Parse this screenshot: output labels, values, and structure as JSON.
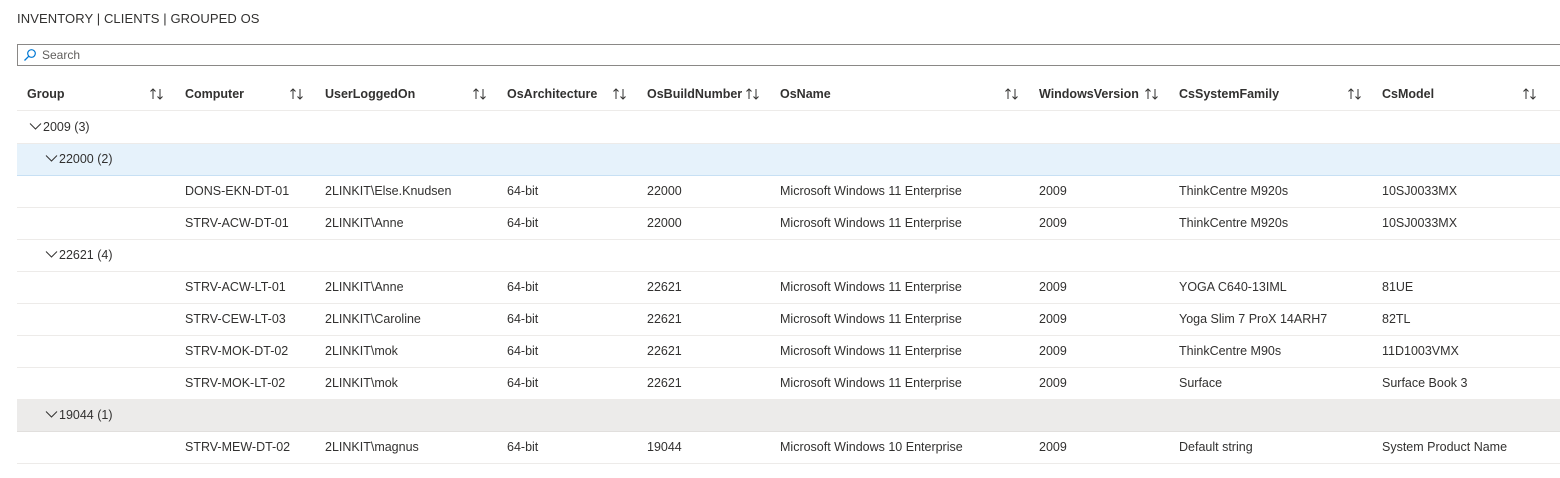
{
  "title": "INVENTORY | CLIENTS | GROUPED OS",
  "search": {
    "placeholder": "Search",
    "value": ""
  },
  "columns": [
    "Group",
    "Computer",
    "UserLoggedOn",
    "OsArchitecture",
    "OsBuildNumber",
    "OsName",
    "WindowsVersion",
    "CsSystemFamily",
    "CsModel"
  ],
  "groups": [
    {
      "label": "2009 (3)",
      "level": 1
    },
    {
      "label": "22000 (2)",
      "level": 2
    },
    {
      "label": "22621 (4)",
      "level": 2
    },
    {
      "label": "19044 (1)",
      "level": 2
    }
  ],
  "rows": [
    [
      "DONS-EKN-DT-01",
      "2LINKIT\\Else.Knudsen",
      "64-bit",
      "22000",
      "Microsoft Windows 11 Enterprise",
      "2009",
      "ThinkCentre M920s",
      "10SJ0033MX"
    ],
    [
      "STRV-ACW-DT-01",
      "2LINKIT\\Anne",
      "64-bit",
      "22000",
      "Microsoft Windows 11 Enterprise",
      "2009",
      "ThinkCentre M920s",
      "10SJ0033MX"
    ],
    [
      "STRV-ACW-LT-01",
      "2LINKIT\\Anne",
      "64-bit",
      "22621",
      "Microsoft Windows 11 Enterprise",
      "2009",
      "YOGA C640-13IML",
      "81UE"
    ],
    [
      "STRV-CEW-LT-03",
      "2LINKIT\\Caroline",
      "64-bit",
      "22621",
      "Microsoft Windows 11 Enterprise",
      "2009",
      "Yoga Slim 7 ProX 14ARH7",
      "82TL"
    ],
    [
      "STRV-MOK-DT-02",
      "2LINKIT\\mok",
      "64-bit",
      "22621",
      "Microsoft Windows 11 Enterprise",
      "2009",
      "ThinkCentre M90s",
      "11D1003VMX"
    ],
    [
      "STRV-MOK-LT-02",
      "2LINKIT\\mok",
      "64-bit",
      "22621",
      "Microsoft Windows 11 Enterprise",
      "2009",
      "Surface",
      "Surface Book 3"
    ],
    [
      "STRV-MEW-DT-02",
      "2LINKIT\\magnus",
      "64-bit",
      "19044",
      "Microsoft Windows 10 Enterprise",
      "2009",
      "Default string",
      "System Product Name"
    ]
  ]
}
